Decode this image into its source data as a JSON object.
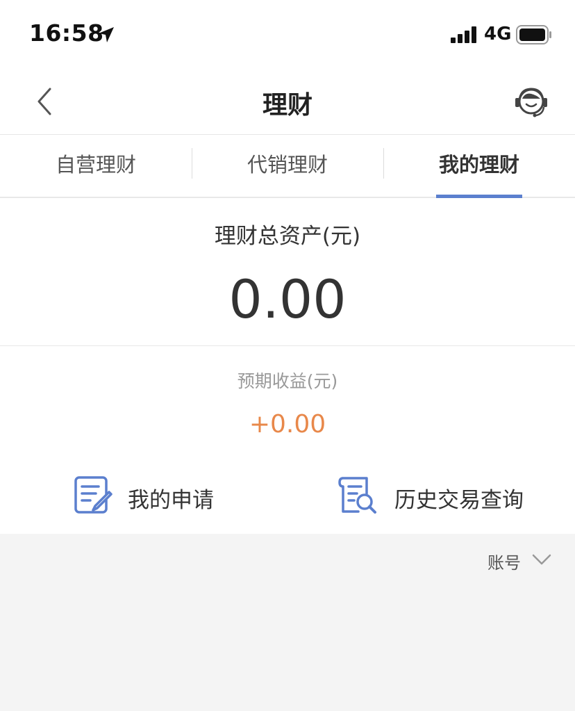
{
  "status_bar": {
    "time": "16:58",
    "network": "4G",
    "icons": [
      "location-arrow-icon",
      "signal-bars-icon",
      "battery-icon"
    ]
  },
  "nav": {
    "title": "理财",
    "back_icon": "chevron-left-icon",
    "service_icon": "customer-service-icon"
  },
  "tabs": [
    {
      "label": "自营理财",
      "active": false
    },
    {
      "label": "代销理财",
      "active": false
    },
    {
      "label": "我的理财",
      "active": true
    }
  ],
  "assets": {
    "label": "理财总资产(元)",
    "value": "0.00",
    "profit_label": "预期收益(元)",
    "profit_value": "+0.00"
  },
  "shortcuts": [
    {
      "label": "我的申请",
      "icon": "application-edit-icon"
    },
    {
      "label": "历史交易查询",
      "icon": "history-search-icon"
    }
  ],
  "account": {
    "label": "账号",
    "icon": "chevron-down-icon"
  },
  "colors": {
    "accent": "#5b7fce",
    "profit": "#e8884a",
    "background_grey": "#f4f4f4"
  }
}
